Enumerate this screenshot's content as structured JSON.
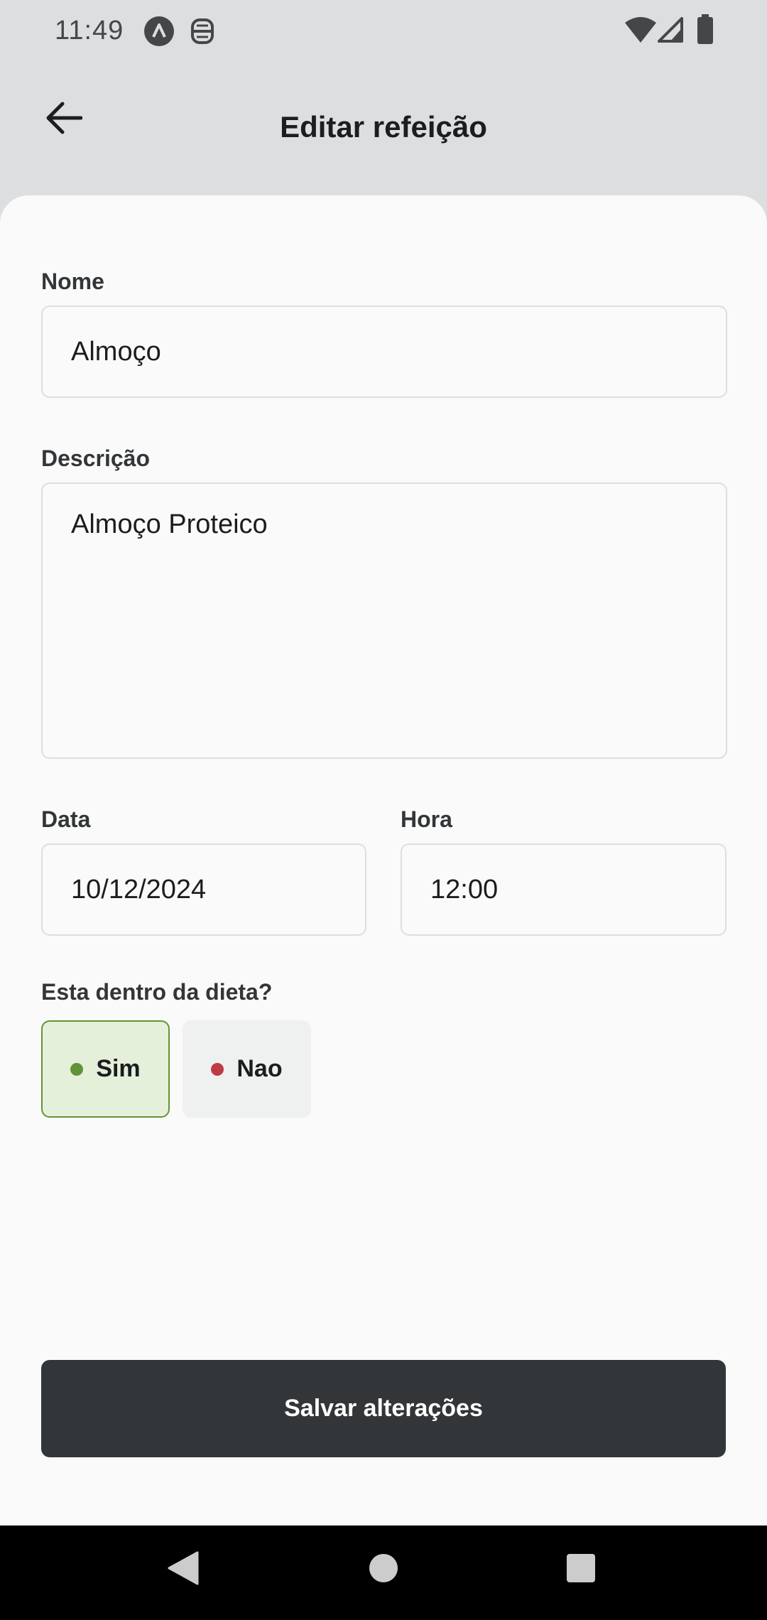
{
  "status_bar": {
    "time": "11:49",
    "icons": [
      "app-notification-icon",
      "debug-icon",
      "wifi-icon",
      "signal-icon",
      "battery-icon"
    ]
  },
  "header": {
    "back_icon": "arrow-left-icon",
    "title": "Editar refeição"
  },
  "form": {
    "name": {
      "label": "Nome",
      "value": "Almoço"
    },
    "description": {
      "label": "Descrição",
      "value": "Almoço Proteico"
    },
    "date": {
      "label": "Data",
      "value": "10/12/2024"
    },
    "time": {
      "label": "Hora",
      "value": "12:00"
    },
    "diet": {
      "label": "Esta dentro da dieta?",
      "yes_label": "Sim",
      "no_label": "Nao",
      "selected": "yes"
    }
  },
  "save_button": {
    "label": "Salvar alterações"
  },
  "colors": {
    "header_bg": "#dddee0",
    "sheet_bg": "#fafafa",
    "field_border": "#dddee0",
    "button_dark": "#333638",
    "green_light": "#e5f0db",
    "green_dark": "#639339",
    "red_dark": "#bf3b44",
    "gray_light": "#eff0f0"
  },
  "nav_bar": {
    "icons": [
      "back-triangle-icon",
      "home-circle-icon",
      "recents-square-icon"
    ]
  }
}
